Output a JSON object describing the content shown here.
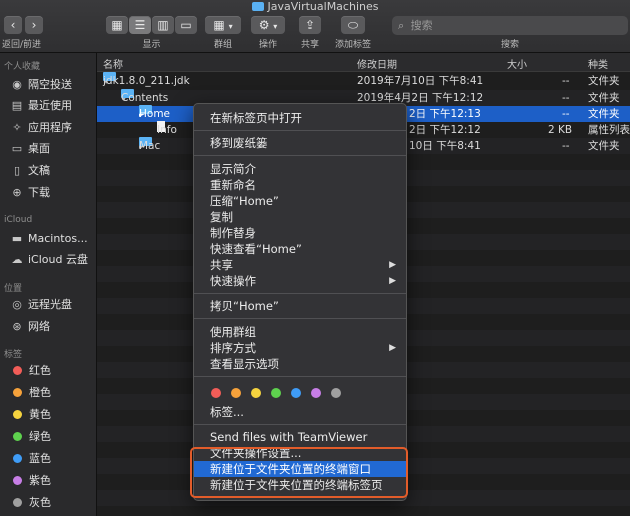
{
  "window": {
    "title": "JavaVirtualMachines"
  },
  "toolbar": {
    "nav_label": "返回/前进",
    "view_label": "显示",
    "group_label": "群组",
    "action_label": "操作",
    "share_label": "共享",
    "add_tag_label": "添加标签",
    "search_label": "搜索",
    "search_placeholder": "搜索"
  },
  "sidebar": {
    "favorites_header": "个人收藏",
    "favorites": [
      {
        "label": "隔空投送",
        "icon": "airdrop-icon"
      },
      {
        "label": "最近使用",
        "icon": "recents-icon"
      },
      {
        "label": "应用程序",
        "icon": "applications-icon"
      },
      {
        "label": "桌面",
        "icon": "desktop-icon"
      },
      {
        "label": "文稿",
        "icon": "documents-icon"
      },
      {
        "label": "下载",
        "icon": "downloads-icon"
      }
    ],
    "icloud_header": "iCloud",
    "icloud": [
      {
        "label": "Macintos...",
        "icon": "disk-icon"
      },
      {
        "label": "iCloud 云盘",
        "icon": "cloud-icon"
      }
    ],
    "locations_header": "位置",
    "locations": [
      {
        "label": "远程光盘",
        "icon": "disc-icon"
      },
      {
        "label": "网络",
        "icon": "network-icon"
      }
    ],
    "tags_header": "标签",
    "tags": [
      {
        "label": "红色",
        "color": "#f25d58"
      },
      {
        "label": "橙色",
        "color": "#f6a23b"
      },
      {
        "label": "黄色",
        "color": "#f5d33f"
      },
      {
        "label": "绿色",
        "color": "#5ed14e"
      },
      {
        "label": "蓝色",
        "color": "#3f9cf6"
      },
      {
        "label": "紫色",
        "color": "#c77ee6"
      },
      {
        "label": "灰色",
        "color": "#a0a0a0"
      }
    ]
  },
  "list": {
    "columns": {
      "name": "名称",
      "modified": "修改日期",
      "size": "大小",
      "kind": "种类"
    },
    "rows": [
      {
        "name": "jdk1.8.0_211.jdk",
        "modified": "2019年7月10日 下午8:41",
        "size": "--",
        "kind": "文件夹"
      },
      {
        "name": "Contents",
        "modified": "2019年4月2日 下午12:12",
        "size": "--",
        "kind": "文件夹"
      },
      {
        "name": "Home",
        "modified": "2日 下午12:13",
        "size": "--",
        "kind": "文件夹"
      },
      {
        "name": "Info",
        "modified": "2日 下午12:12",
        "size": "2 KB",
        "kind": "属性列表"
      },
      {
        "name": "Mac",
        "modified": "10日 下午8:41",
        "size": "--",
        "kind": "文件夹"
      }
    ]
  },
  "menu": {
    "open_new_tab": "在新标签页中打开",
    "move_trash": "移到废纸篓",
    "get_info": "显示简介",
    "rename": "重新命名",
    "compress": "压缩“Home”",
    "duplicate": "复制",
    "make_alias": "制作替身",
    "quick_look": "快速查看“Home”",
    "share": "共享",
    "quick_actions": "快速操作",
    "copy": "拷贝“Home”",
    "use_groups": "使用群组",
    "sort_by": "排序方式",
    "show_view_options": "查看显示选项",
    "tags": "标签...",
    "teamviewer": "Send files with TeamViewer",
    "folder_actions": "文件夹操作设置...",
    "new_terminal": "新建位于文件夹位置的终端窗口",
    "new_terminal_tab": "新建位于文件夹位置的终端标签页",
    "tag_colors": [
      "#f25d58",
      "#f6a23b",
      "#f5d33f",
      "#5ed14e",
      "#3f9cf6",
      "#c77ee6",
      "#a0a0a0"
    ]
  }
}
